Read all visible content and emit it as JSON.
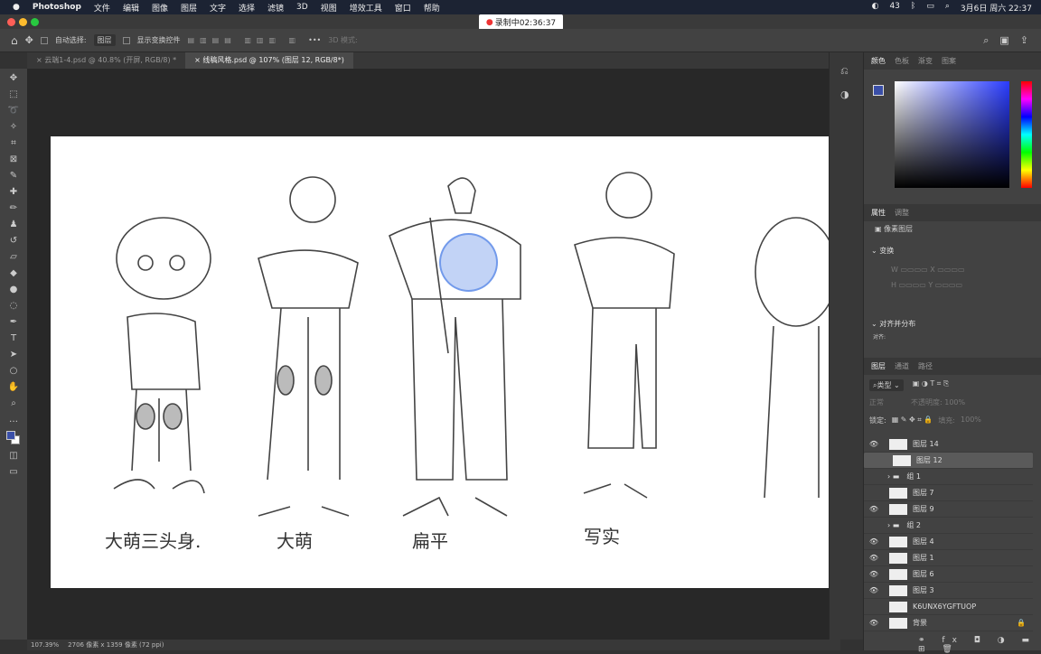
{
  "menubar": {
    "app": "Photoshop",
    "items": [
      "文件",
      "编辑",
      "图像",
      "图层",
      "文字",
      "选择",
      "滤镜",
      "3D",
      "视图",
      "增效工具",
      "窗口",
      "帮助"
    ],
    "status_badge": "43",
    "datetime": "3月6日 周六 22:37"
  },
  "recording": {
    "label": "录制中02:36:37"
  },
  "options": {
    "auto_select": "自动选择:",
    "auto_select_value": "图层",
    "show_transform": "显示变换控件",
    "mode_3d": "3D 模式:"
  },
  "tabs": [
    {
      "label": "云端1-4.psd @ 40.8% (开屏, RGB/8) *"
    },
    {
      "label": "线稿风格.psd @ 107% (图层 12, RGB/8*)"
    }
  ],
  "canvas": {
    "captions": [
      "大萌三头身.",
      "大萌",
      "扁平",
      "写实"
    ]
  },
  "color_panel": {
    "tabs": [
      "颜色",
      "色板",
      "渐变",
      "图案"
    ],
    "foreground": "#3a4fa8",
    "background": "#ffffff",
    "hue": "#2a3cff"
  },
  "properties": {
    "tabs": [
      "属性",
      "调整"
    ],
    "kind": "像素图层",
    "transform": "变换",
    "w": "W",
    "x": "X",
    "h": "H",
    "y": "Y",
    "align": "对齐并分布",
    "align_sub": "对齐:"
  },
  "layers": {
    "tabs": [
      "图层",
      "通道",
      "路径"
    ],
    "filter": "类型",
    "blend": "正常",
    "opacity_label": "不透明度:",
    "opacity": "100%",
    "lock_label": "锁定:",
    "fill_label": "填充:",
    "fill": "100%",
    "rows": [
      {
        "name": "图层 14",
        "visible": true
      },
      {
        "name": "图层 12",
        "visible": false,
        "selected": true
      },
      {
        "name": "组 1",
        "visible": false,
        "group": true
      },
      {
        "name": "图层 7",
        "visible": false
      },
      {
        "name": "图层 9",
        "visible": true
      },
      {
        "name": "组 2",
        "visible": false,
        "group": true
      },
      {
        "name": "图层 4",
        "visible": true
      },
      {
        "name": "图层 1",
        "visible": true
      },
      {
        "name": "图层 6",
        "visible": true
      },
      {
        "name": "图层 3",
        "visible": true
      },
      {
        "name": "K6UNX6YGFTUOP",
        "visible": false
      },
      {
        "name": "背景",
        "visible": true,
        "locked": true
      }
    ]
  },
  "status": {
    "zoom": "107.39%",
    "size": "2706 像素 x 1359 像素 (72 ppi)"
  }
}
